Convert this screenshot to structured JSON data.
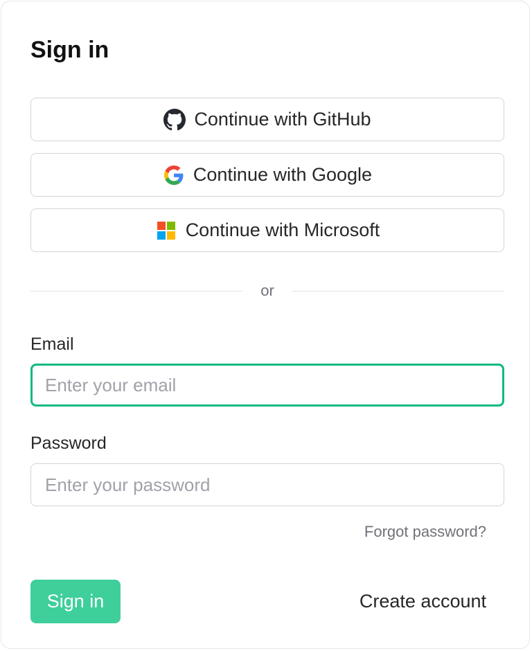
{
  "title": "Sign in",
  "oauth": {
    "github_label": "Continue with GitHub",
    "google_label": "Continue with Google",
    "microsoft_label": "Continue with Microsoft"
  },
  "divider": {
    "text": "or"
  },
  "email": {
    "label": "Email",
    "value": "",
    "placeholder": "Enter your email",
    "focused": true
  },
  "password": {
    "label": "Password",
    "value": "",
    "placeholder": "Enter your password"
  },
  "forgot_password_label": "Forgot password?",
  "submit_label": "Sign in",
  "create_account_label": "Create account",
  "icons": {
    "github": "github-icon",
    "google": "google-icon",
    "microsoft": "microsoft-icon"
  },
  "colors": {
    "accent": "#3ecf9b",
    "focus_ring": "#10b981",
    "border": "#d4d4d8",
    "text": "#27272a",
    "muted": "#71717a"
  }
}
